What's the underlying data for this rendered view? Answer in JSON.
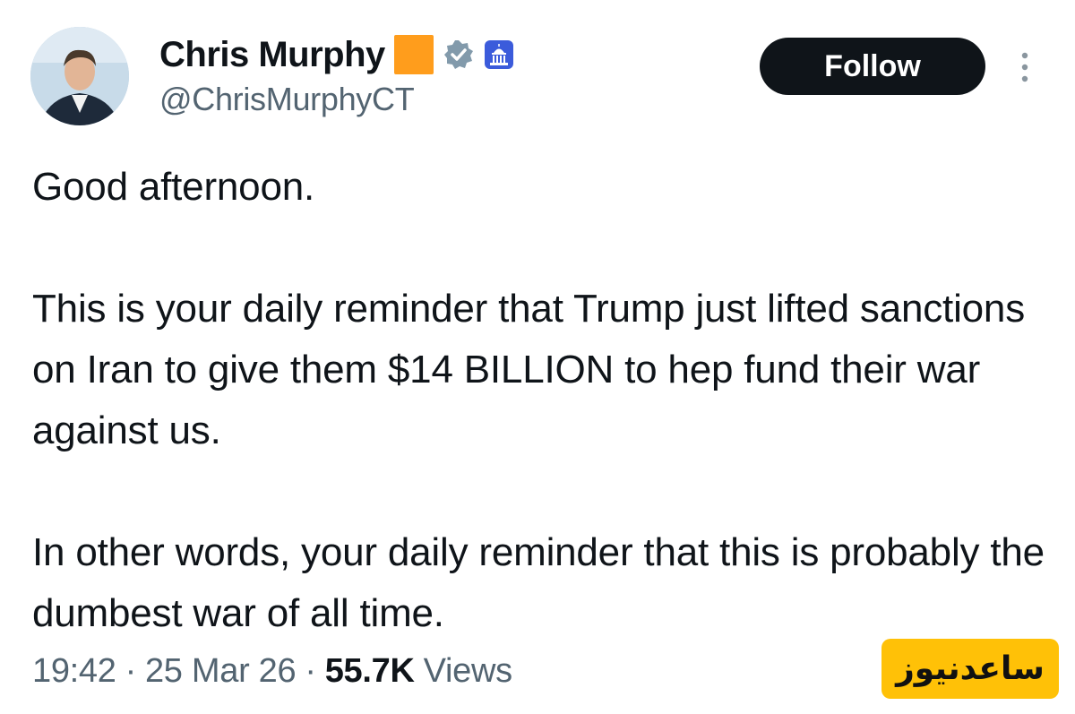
{
  "author": {
    "name": "Chris Murphy",
    "handle": "@ChrisMurphyCT",
    "emoji_color": "#ff9d1c",
    "verified_icon": "verified-badge-icon",
    "affiliation_icon": "capitol-building-icon"
  },
  "follow_label": "Follow",
  "tweet": {
    "paragraphs": [
      "Good afternoon.",
      "This is your daily reminder that Trump just lifted sanctions on Iran to give them $14 BILLION to hep fund their war against us.",
      "In other words, your daily reminder that this is probably the dumbest war of all time."
    ]
  },
  "meta": {
    "time": "19:42",
    "sep1": "·",
    "date": "25 Mar 26",
    "sep2": "·",
    "views_count": "55.7K",
    "views_label": "Views"
  },
  "watermark": {
    "text": "ساعدنیوز"
  },
  "colors": {
    "text": "#0f1419",
    "secondary": "#536471",
    "button_bg": "#0f1419",
    "watermark_bg": "#ffc107"
  }
}
